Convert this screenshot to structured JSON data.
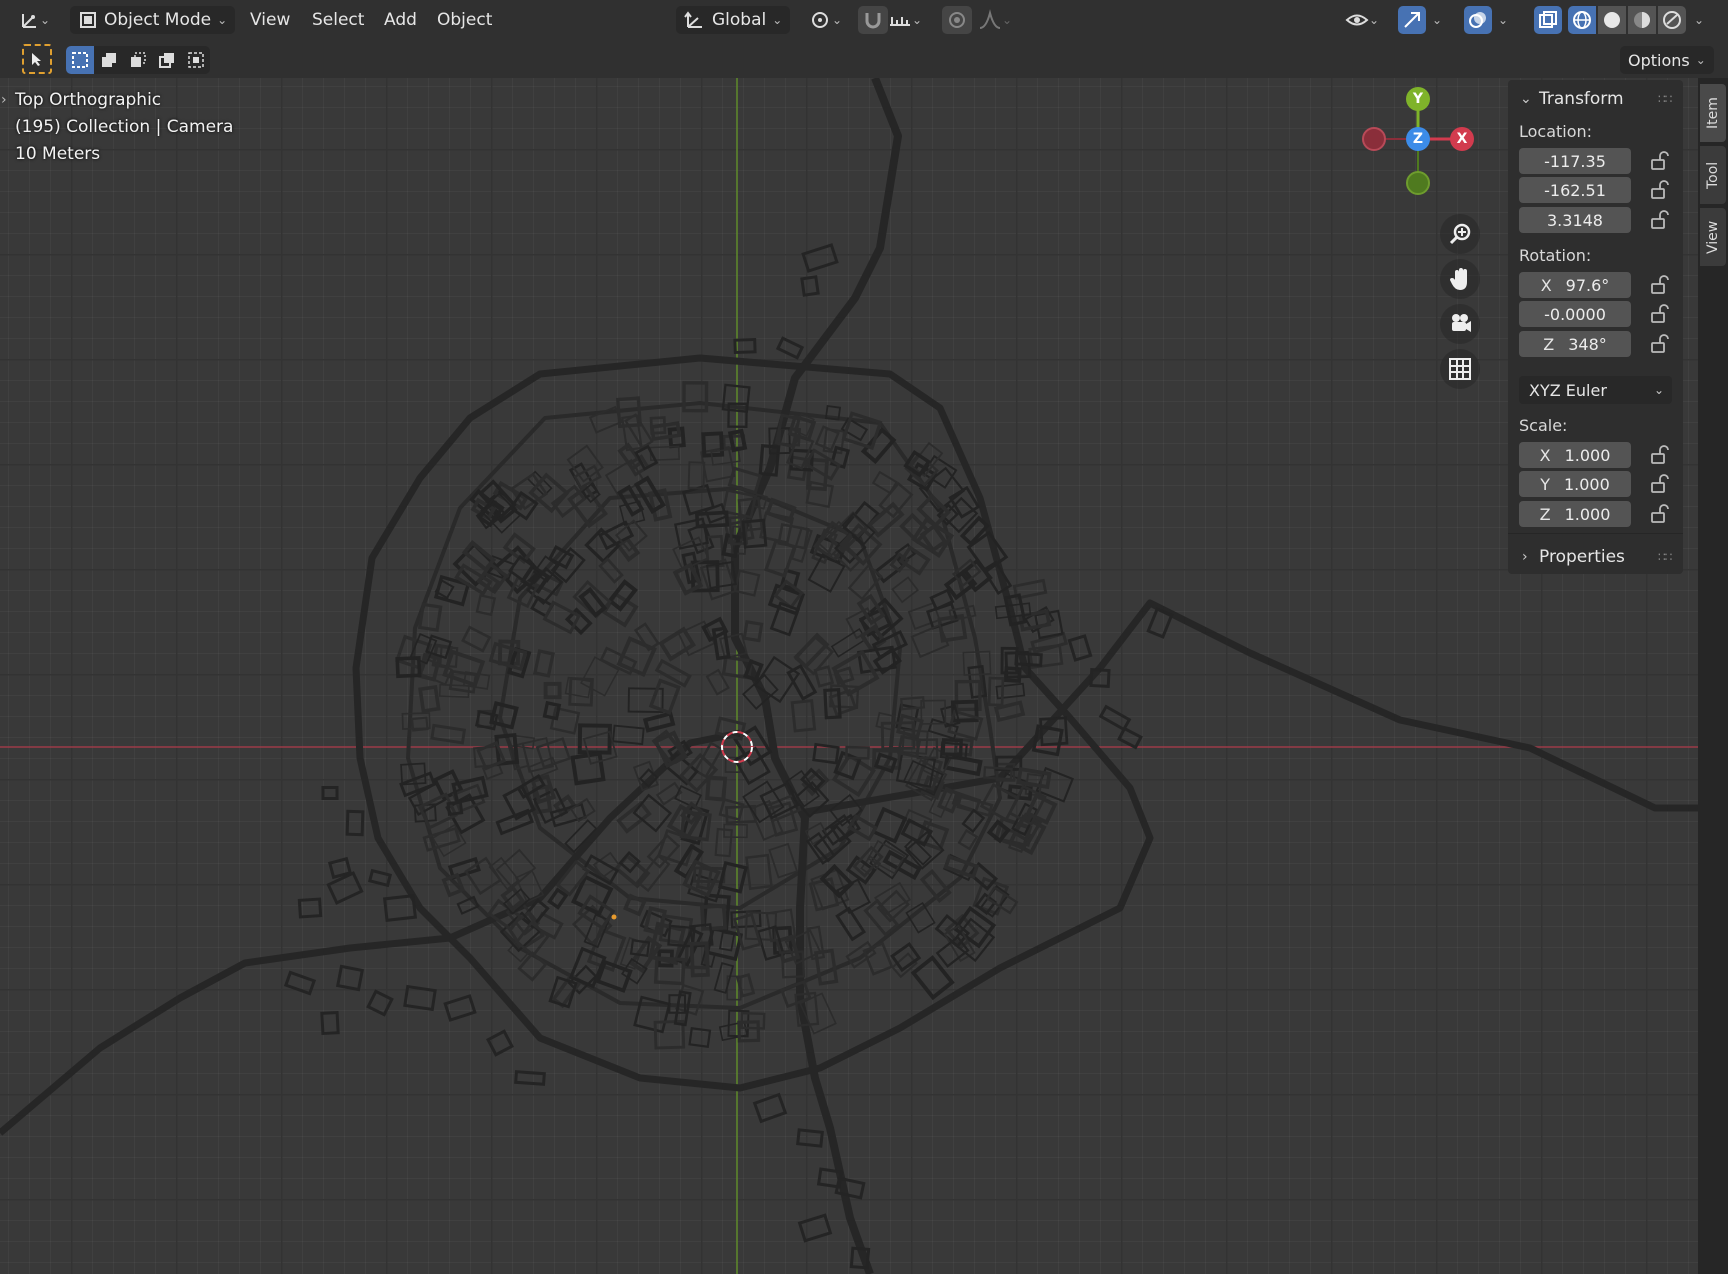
{
  "header": {
    "mode_label": "Object Mode",
    "menus": [
      "View",
      "Select",
      "Add",
      "Object"
    ],
    "orientation_label": "Global",
    "options_label": "Options"
  },
  "viewport": {
    "view_name": "Top Orthographic",
    "collection_info": "(195) Collection | Camera",
    "scale_info": "10 Meters"
  },
  "gizmo": {
    "y": "Y",
    "z": "Z",
    "x": "X"
  },
  "npanel": {
    "transform_label": "Transform",
    "location_label": "Location:",
    "location": [
      "-117.35",
      "-162.51",
      "3.3148"
    ],
    "rotation_label": "Rotation:",
    "rotation_axes": [
      "X",
      "",
      "Z"
    ],
    "rotation": [
      "97.6°",
      "-0.0000",
      "348°"
    ],
    "rotation_mode": "XYZ Euler",
    "scale_label": "Scale:",
    "scale_axes": [
      "X",
      "Y",
      "Z"
    ],
    "scale": [
      "1.000",
      "1.000",
      "1.000"
    ],
    "properties_label": "Properties"
  },
  "side_tabs": [
    "Item",
    "Tool",
    "View"
  ],
  "colors": {
    "x_axis": "#d23b4e",
    "y_axis": "#7fb32a",
    "z_axis": "#3c8ce8",
    "accent": "#4772b3"
  }
}
